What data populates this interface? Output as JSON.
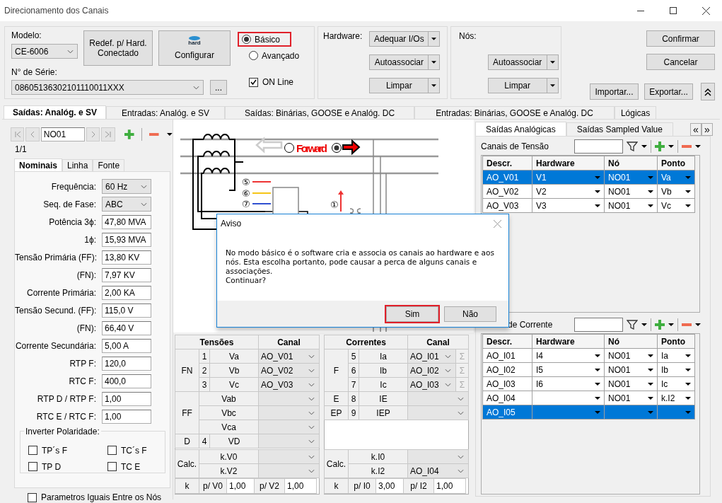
{
  "window": {
    "title": "Direcionamento dos Canais"
  },
  "device": {
    "model_label": "Modelo:",
    "model": "CE-6006",
    "serial_label": "N° de Série:",
    "serial": "08605136302101110011XXX",
    "browse": "...",
    "reset_button": "Redef. p/ Hard. Conectado",
    "configure_logo": "hard",
    "configure_button": "Configurar"
  },
  "mode": [
    {
      "label": "Básico",
      "selected": true,
      "highlighted": true
    },
    {
      "label": "Avançado",
      "selected": false,
      "highlighted": false
    }
  ],
  "online": {
    "label": "ON Line",
    "checked": true
  },
  "hardware": {
    "label": "Hardware:",
    "buttons": [
      "Adequar I/Os",
      "Autoassociar",
      "Limpar"
    ]
  },
  "nodes": {
    "label": "Nós:",
    "buttons": [
      "Autoassociar",
      "Limpar"
    ]
  },
  "actions": [
    "Confirmar",
    "Cancelar"
  ],
  "transfer": [
    "Importar...",
    "Exportar..."
  ],
  "main_tabs": [
    {
      "label": "Saídas: Analóg. e SV",
      "selected": true
    },
    {
      "label": "Entradas: Analóg. e SV",
      "selected": false
    },
    {
      "label": "Saídas: Binárias, GOOSE e Analóg. DC",
      "selected": false
    },
    {
      "label": "Entradas: Binárias, GOOSE e Analóg. DC",
      "selected": false
    },
    {
      "label": "Lógicas",
      "selected": false
    }
  ],
  "navigator": {
    "value": "NO01",
    "position": "1/1",
    "buttons": [
      {
        "kind": "first",
        "disabled": true
      },
      {
        "kind": "prev",
        "disabled": true
      },
      {
        "kind": "next",
        "disabled": true
      },
      {
        "kind": "last",
        "disabled": true
      }
    ]
  },
  "sub_tabs": [
    {
      "label": "Nominais",
      "selected": true
    },
    {
      "label": "Linha",
      "selected": false
    },
    {
      "label": "Fonte",
      "selected": false
    }
  ],
  "nominals": [
    {
      "label": "Frequência:",
      "value": "60 Hz",
      "kind": "select"
    },
    {
      "label": "Seq. de Fase:",
      "value": "ABC",
      "kind": "select"
    },
    {
      "label": "Potência 3ϕ:",
      "value": "47,80 MVA",
      "kind": "input"
    },
    {
      "label": "1ϕ:",
      "value": "15,93 MVA",
      "kind": "input"
    },
    {
      "label": "Tensão Primária (FF):",
      "value": "13,80 KV",
      "kind": "input"
    },
    {
      "label": "(FN):",
      "value": "7,97 KV",
      "kind": "input"
    },
    {
      "label": "Corrente Primária:",
      "value": "2,00 KA",
      "kind": "input"
    },
    {
      "label": "Tensão Secund. (FF):",
      "value": "115,0 V",
      "kind": "input"
    },
    {
      "label": "(FN):",
      "value": "66,40 V",
      "kind": "input"
    },
    {
      "label": "Corrente Secundária:",
      "value": "5,00 A",
      "kind": "input"
    },
    {
      "label": "RTP F:",
      "value": "120,0",
      "kind": "input"
    },
    {
      "label": "RTC F:",
      "value": "400,0",
      "kind": "input"
    },
    {
      "label": "RTP D / RTP F:",
      "value": "1,00",
      "kind": "input"
    },
    {
      "label": "RTC E / RTC F:",
      "value": "1,00",
      "kind": "input"
    }
  ],
  "polarity": {
    "title": "Inverter Polaridade:",
    "options": [
      {
        "label": "TP´s F",
        "checked": false
      },
      {
        "label": "TC´s F",
        "checked": false
      },
      {
        "label": "TP D",
        "checked": false
      },
      {
        "label": "TC E",
        "checked": false
      }
    ]
  },
  "same_params": {
    "label": "Parametros Iguais Entre os Nós",
    "checked": false
  },
  "diagram": {
    "direction_label": "Forward",
    "direction": [
      {
        "selected": false
      },
      {
        "selected": true
      }
    ],
    "markers": [
      "⑤",
      "⑥",
      "⑦",
      "①"
    ]
  },
  "voltages": {
    "columns": [
      "Tensões",
      "Canal"
    ],
    "groups": [
      {
        "group": "FN",
        "rows": [
          {
            "num": "1",
            "name": "Va",
            "channel": "AO_V01"
          },
          {
            "num": "2",
            "name": "Vb",
            "channel": "AO_V02"
          },
          {
            "num": "3",
            "name": "Vc",
            "channel": "AO_V03"
          }
        ]
      },
      {
        "group": "FF",
        "rows": [
          {
            "name": "Vab"
          },
          {
            "name": "Vbc"
          },
          {
            "name": "Vca"
          }
        ]
      },
      {
        "group": "D",
        "rows": [
          {
            "num": "4",
            "name": "VD"
          }
        ]
      },
      {
        "group": "Calc.",
        "rows": [
          {
            "name": "k.V0"
          },
          {
            "name": "k.V2"
          }
        ]
      }
    ],
    "k": {
      "label": "k",
      "items": [
        {
          "label": "p/ V0",
          "value": "1,00"
        },
        {
          "label": "p/ V2",
          "value": "1,00"
        }
      ]
    }
  },
  "currents": {
    "columns": [
      "Correntes",
      "Canal"
    ],
    "groups": [
      {
        "group": "F",
        "rows": [
          {
            "num": "5",
            "name": "Ia",
            "channel": "AO_I01",
            "sum": "Σ"
          },
          {
            "num": "6",
            "name": "Ib",
            "channel": "AO_I02",
            "sum": "Σ"
          },
          {
            "num": "7",
            "name": "Ic",
            "channel": "AO_I03",
            "sum": "Σ"
          }
        ]
      },
      {
        "group": "E",
        "rows": [
          {
            "num": "8",
            "name": "IE"
          }
        ]
      },
      {
        "group": "EP",
        "rows": [
          {
            "num": "9",
            "name": "IEP"
          }
        ]
      },
      {
        "group": "Calc.",
        "rows": [
          {
            "name": "k.I0"
          },
          {
            "name": "k.I2",
            "channel": "AO_I04"
          }
        ]
      }
    ],
    "k": {
      "label": "k",
      "items": [
        {
          "label": "p/ I0",
          "value": "3,00"
        },
        {
          "label": "p/ I2",
          "value": "1,00"
        }
      ]
    }
  },
  "right_tabs": [
    {
      "label": "Saídas Analógicas",
      "selected": true
    },
    {
      "label": "Saídas Sampled Value",
      "selected": false
    }
  ],
  "right_nav": [
    "«",
    "»"
  ],
  "voltage_channels": {
    "label": "Canais de Tensão",
    "columns": [
      "Descr.",
      "Hardware",
      "Nó",
      "Ponto"
    ],
    "rows": [
      {
        "descr": "AO_V01",
        "hardware": "V1",
        "node": "NO01",
        "point": "Va",
        "selected": true
      },
      {
        "descr": "AO_V02",
        "hardware": "V2",
        "node": "NO01",
        "point": "Vb",
        "selected": false
      },
      {
        "descr": "AO_V03",
        "hardware": "V3",
        "node": "NO01",
        "point": "Vc",
        "selected": false
      }
    ]
  },
  "current_channels": {
    "label": "de Corrente",
    "columns": [
      "Descr.",
      "Hardware",
      "Nó",
      "Ponto"
    ],
    "rows": [
      {
        "descr": "AO_I01",
        "hardware": "I4",
        "node": "NO01",
        "point": "Ia",
        "selected": false
      },
      {
        "descr": "AO_I02",
        "hardware": "I5",
        "node": "NO01",
        "point": "Ib",
        "selected": false
      },
      {
        "descr": "AO_I03",
        "hardware": "I6",
        "node": "NO01",
        "point": "Ic",
        "selected": false
      },
      {
        "descr": "AO_I04",
        "node": "NO01",
        "point": "k.I2",
        "selected": false
      },
      {
        "descr": "AO_I05",
        "selected": true
      }
    ]
  },
  "dialog": {
    "title": "Aviso",
    "message": "No modo básico é o software cria e associa os canais ao hardware e aos nós. Esta escolha portanto, pode causar a perca de alguns canais e associações.\nContinuar?",
    "buttons": [
      {
        "label": "Sim",
        "highlighted": true
      },
      {
        "label": "Não",
        "highlighted": false
      }
    ]
  }
}
